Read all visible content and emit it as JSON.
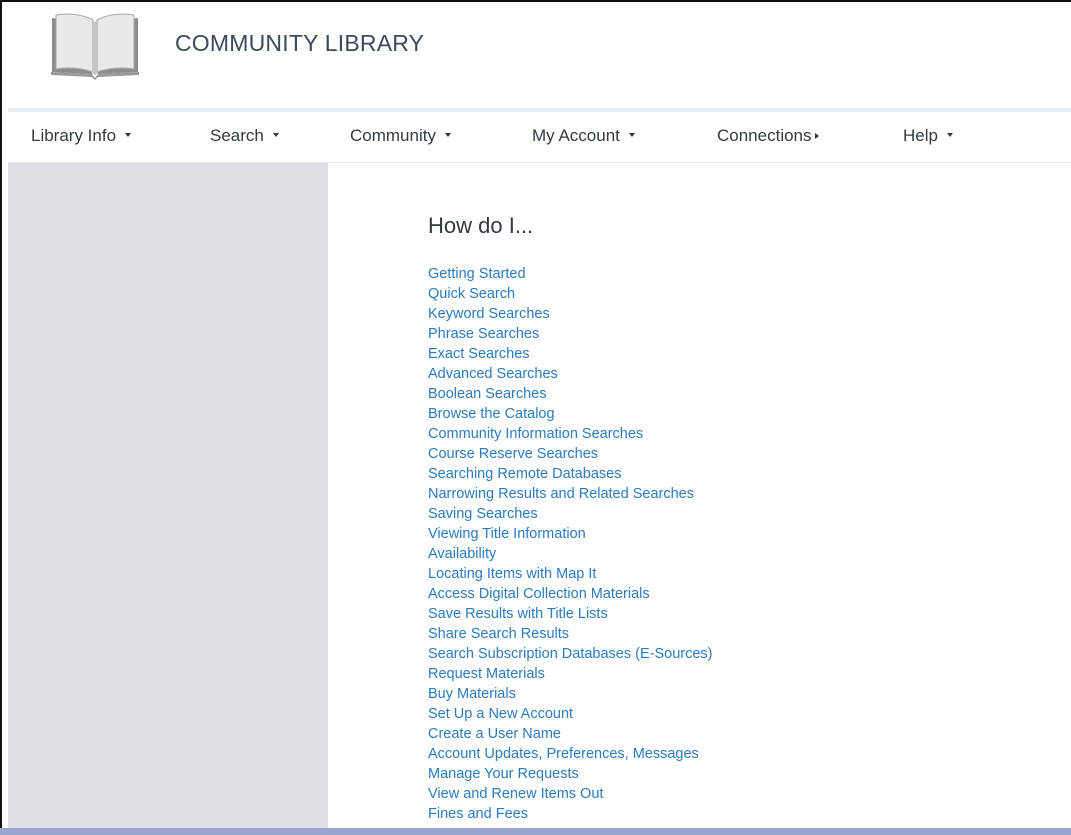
{
  "header": {
    "site_title": "COMMUNITY LIBRARY",
    "logo_icon": "open-book-icon"
  },
  "nav": {
    "items": [
      {
        "label": "Library Info",
        "indicator": "caret-down"
      },
      {
        "label": "Search",
        "indicator": "caret-down"
      },
      {
        "label": "Community",
        "indicator": "caret-down"
      },
      {
        "label": "My Account",
        "indicator": "caret-down"
      },
      {
        "label": "Connections",
        "indicator": "caret-right"
      },
      {
        "label": "Help",
        "indicator": "caret-down"
      }
    ]
  },
  "main": {
    "heading": "How do I...",
    "links": [
      "Getting Started",
      "Quick Search",
      "Keyword Searches",
      "Phrase Searches",
      "Exact Searches",
      "Advanced Searches",
      "Boolean Searches",
      "Browse the Catalog",
      "Community Information Searches",
      "Course Reserve Searches",
      "Searching Remote Databases",
      "Narrowing Results and Related Searches",
      "Saving Searches",
      "Viewing Title Information",
      "Availability",
      "Locating Items with Map It",
      "Access Digital Collection Materials",
      "Save Results with Title Lists",
      "Share Search Results",
      "Search Subscription Databases (E-Sources)",
      "Request Materials",
      "Buy Materials",
      "Set Up a New Account",
      "Create a User Name",
      "Account Updates, Preferences, Messages",
      "Manage Your Requests",
      "View and Renew Items Out",
      "Fines and Fees"
    ]
  },
  "colors": {
    "link": "#2b7bbf",
    "nav_text": "#333a44",
    "title_text": "#3c4a5c",
    "sidebar_bg": "#dde1e5",
    "bottom_bar": "#9aa4cf"
  }
}
